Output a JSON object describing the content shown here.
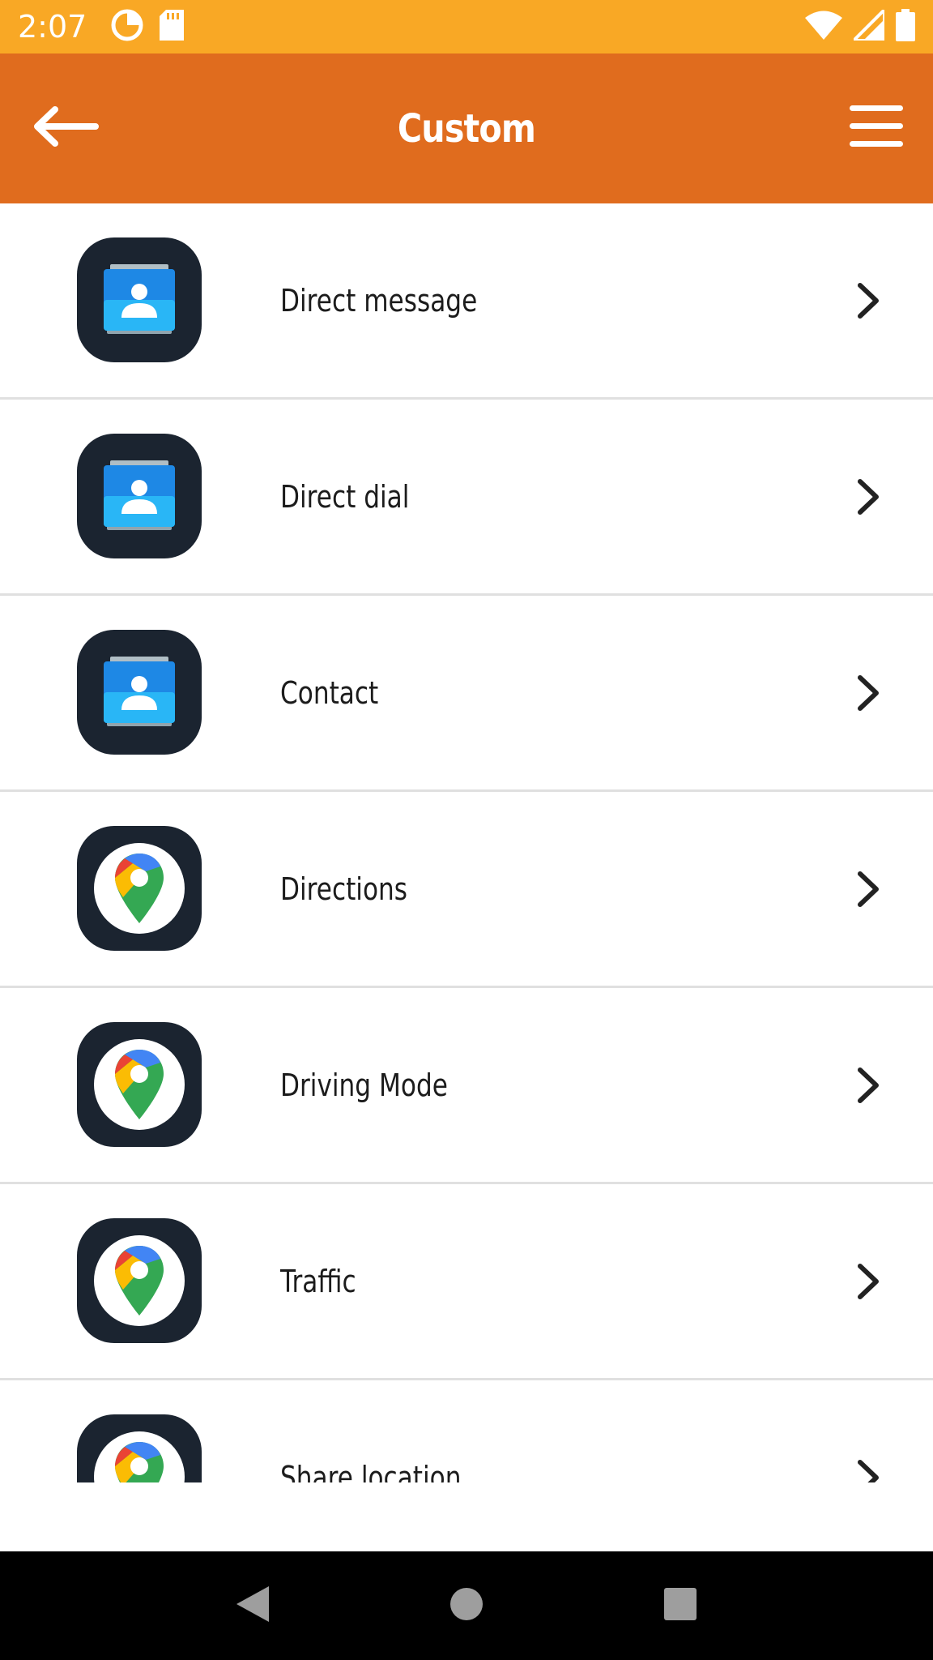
{
  "status_bar": {
    "time": "2:07",
    "icons": [
      "data-saver-icon",
      "sd-card-icon",
      "wifi-icon",
      "signal-icon",
      "battery-icon"
    ]
  },
  "app_bar": {
    "title": "Custom",
    "back_icon": "arrow-left-icon",
    "menu_icon": "hamburger-menu-icon"
  },
  "list": {
    "items": [
      {
        "label": "Direct message",
        "icon": "contacts-app-icon"
      },
      {
        "label": "Direct dial",
        "icon": "contacts-app-icon"
      },
      {
        "label": "Contact",
        "icon": "contacts-app-icon"
      },
      {
        "label": "Directions",
        "icon": "google-maps-icon"
      },
      {
        "label": "Driving Mode",
        "icon": "google-maps-icon"
      },
      {
        "label": "Traffic",
        "icon": "google-maps-icon"
      },
      {
        "label": "Share location",
        "icon": "google-maps-icon"
      }
    ]
  },
  "nav_bar": {
    "icons": [
      "back-triangle-icon",
      "home-circle-icon",
      "recents-square-icon"
    ]
  },
  "colors": {
    "status_bar": "#F9A825",
    "app_bar": "#E06C1E",
    "icon_tile": "#1b2430",
    "contacts_blue": "#1E88E5"
  }
}
